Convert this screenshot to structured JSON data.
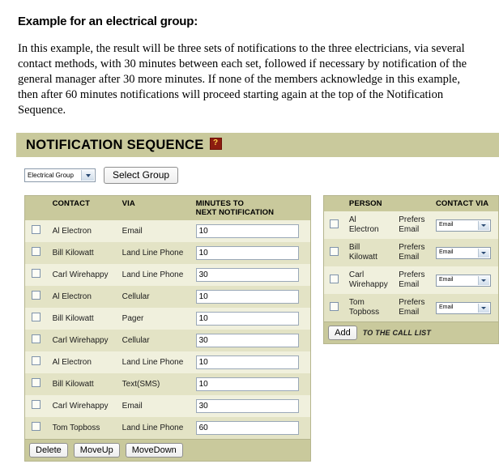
{
  "intro": {
    "title": "Example for an electrical group:",
    "body": "In this example, the result will be three sets of notifications to the three electricians, via several contact methods, with 30 minutes between each set, followed if necessary by notification of the general manager after 30 more minutes. If none of the members acknowledge in this example, then after 60 minutes notifications will proceed starting again at the top of the Notification Sequence."
  },
  "section": {
    "title": "NOTIFICATION SEQUENCE",
    "help_icon": "help-question-icon",
    "help_glyph": "?"
  },
  "group_selector": {
    "selected": "Electrical Group",
    "dropdown_icon": "chevron-down-icon",
    "button_label": "Select Group"
  },
  "sequence_table": {
    "headers": [
      "",
      "CONTACT",
      "VIA",
      "MINUTES TO\nNEXT NOTIFICATION"
    ],
    "header_minutes_line1": "MINUTES TO",
    "header_minutes_line2": "NEXT NOTIFICATION",
    "header_contact": "CONTACT",
    "header_via": "VIA",
    "rows": [
      {
        "checked": false,
        "contact": "Al Electron",
        "via": "Email",
        "minutes": "10"
      },
      {
        "checked": false,
        "contact": "Bill Kilowatt",
        "via": "Land Line Phone",
        "minutes": "10"
      },
      {
        "checked": false,
        "contact": "Carl Wirehappy",
        "via": "Land Line Phone",
        "minutes": "30"
      },
      {
        "checked": false,
        "contact": "Al Electron",
        "via": "Cellular",
        "minutes": "10"
      },
      {
        "checked": false,
        "contact": "Bill Kilowatt",
        "via": "Pager",
        "minutes": "10"
      },
      {
        "checked": false,
        "contact": "Carl Wirehappy",
        "via": "Cellular",
        "minutes": "30"
      },
      {
        "checked": false,
        "contact": "Al Electron",
        "via": "Land Line Phone",
        "minutes": "10"
      },
      {
        "checked": false,
        "contact": "Bill Kilowatt",
        "via": "Text(SMS)",
        "minutes": "10"
      },
      {
        "checked": false,
        "contact": "Carl Wirehappy",
        "via": "Email",
        "minutes": "30"
      },
      {
        "checked": false,
        "contact": "Tom Topboss",
        "via": "Land Line Phone",
        "minutes": "60"
      }
    ],
    "footer_buttons": [
      {
        "label": "Delete"
      },
      {
        "label": "MoveUp"
      },
      {
        "label": "MoveDown"
      }
    ]
  },
  "person_table": {
    "header_person": "PERSON",
    "header_blank": "",
    "header_contact_via": "CONTACT VIA",
    "rows": [
      {
        "checked": false,
        "name_line1": "Al",
        "name_line2": "Electron",
        "prefers_line1": "Prefers",
        "prefers_line2": "Email",
        "contact_via": "Email"
      },
      {
        "checked": false,
        "name_line1": "Bill",
        "name_line2": "Kilowatt",
        "prefers_line1": "Prefers",
        "prefers_line2": "Email",
        "contact_via": "Email"
      },
      {
        "checked": false,
        "name_line1": "Carl",
        "name_line2": "Wirehappy",
        "prefers_line1": "Prefers",
        "prefers_line2": "Email",
        "contact_via": "Email"
      },
      {
        "checked": false,
        "name_line1": "Tom",
        "name_line2": "Topboss",
        "prefers_line1": "Prefers",
        "prefers_line2": "Email",
        "contact_via": "Email"
      }
    ],
    "add_button_label": "Add",
    "add_caption": "TO THE CALL LIST"
  },
  "colors": {
    "bar_khaki": "#c9c99c",
    "row_light": "#f0f0dd",
    "row_dark": "#e3e3c5",
    "panel_border": "#b5b58e",
    "help_bg": "#8c1c10",
    "help_fg": "#ffd24d"
  }
}
